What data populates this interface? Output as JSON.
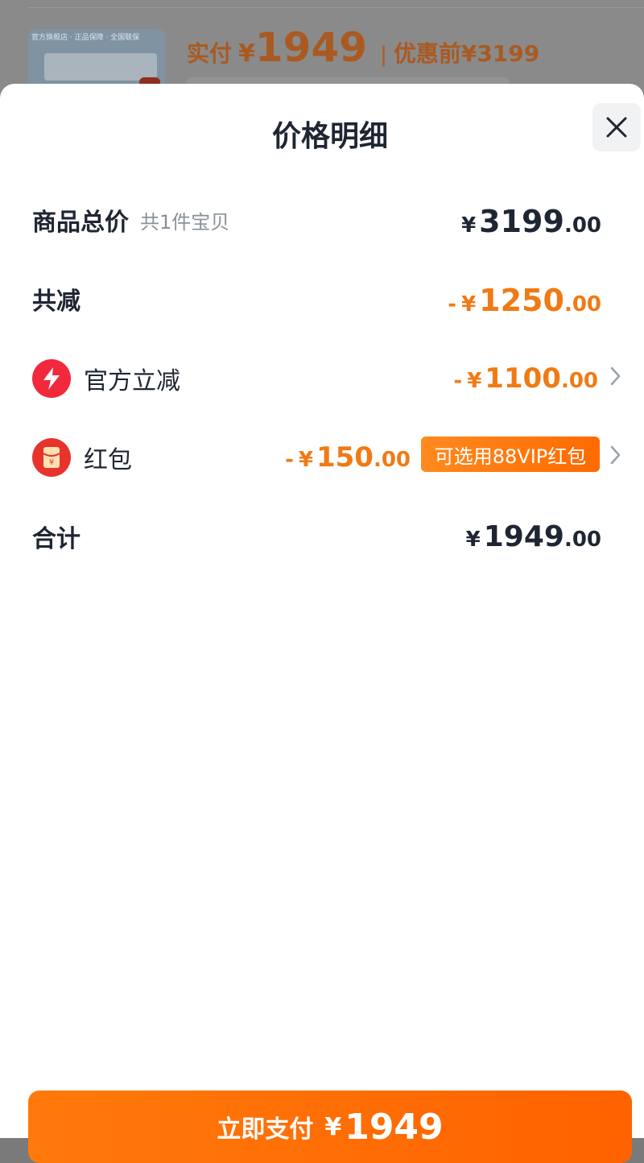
{
  "background": {
    "thumbnail_caption": "官方旗舰店 · 正品保障 · 全国联保",
    "paid_label": "实付",
    "currency": "¥",
    "paid_amount": "1949",
    "separator": "|",
    "before_discount_label": "优惠前",
    "before_discount_amount": "¥3199"
  },
  "sheet": {
    "title": "价格明细",
    "close_icon": "close-icon"
  },
  "rows": {
    "total": {
      "label": "商品总价",
      "sub": "共1件宝贝",
      "currency": "¥",
      "int": "3199",
      "dec": ".00"
    },
    "reduction": {
      "label": "共减",
      "sign": "-",
      "currency": "¥",
      "int": "1250",
      "dec": ".00"
    },
    "official": {
      "icon": "lightning-icon",
      "label": "官方立减",
      "sign": "-",
      "currency": "¥",
      "int": "1100",
      "dec": ".00"
    },
    "redpacket": {
      "icon": "red-packet-icon",
      "label": "红包",
      "sign": "-",
      "currency": "¥",
      "int": "150",
      "dec": ".00",
      "badge": "可选用88VIP红包"
    },
    "sum": {
      "label": "合计",
      "currency": "¥",
      "int": "1949",
      "dec": ".00"
    }
  },
  "pay_button": {
    "label": "立即支付",
    "currency": "¥",
    "amount": "1949"
  },
  "colors": {
    "accent": "#ff6a00",
    "discount": "#f07a14",
    "text": "#1f2633",
    "lightning": "#f2283c",
    "red_packet": "#e8322c"
  }
}
